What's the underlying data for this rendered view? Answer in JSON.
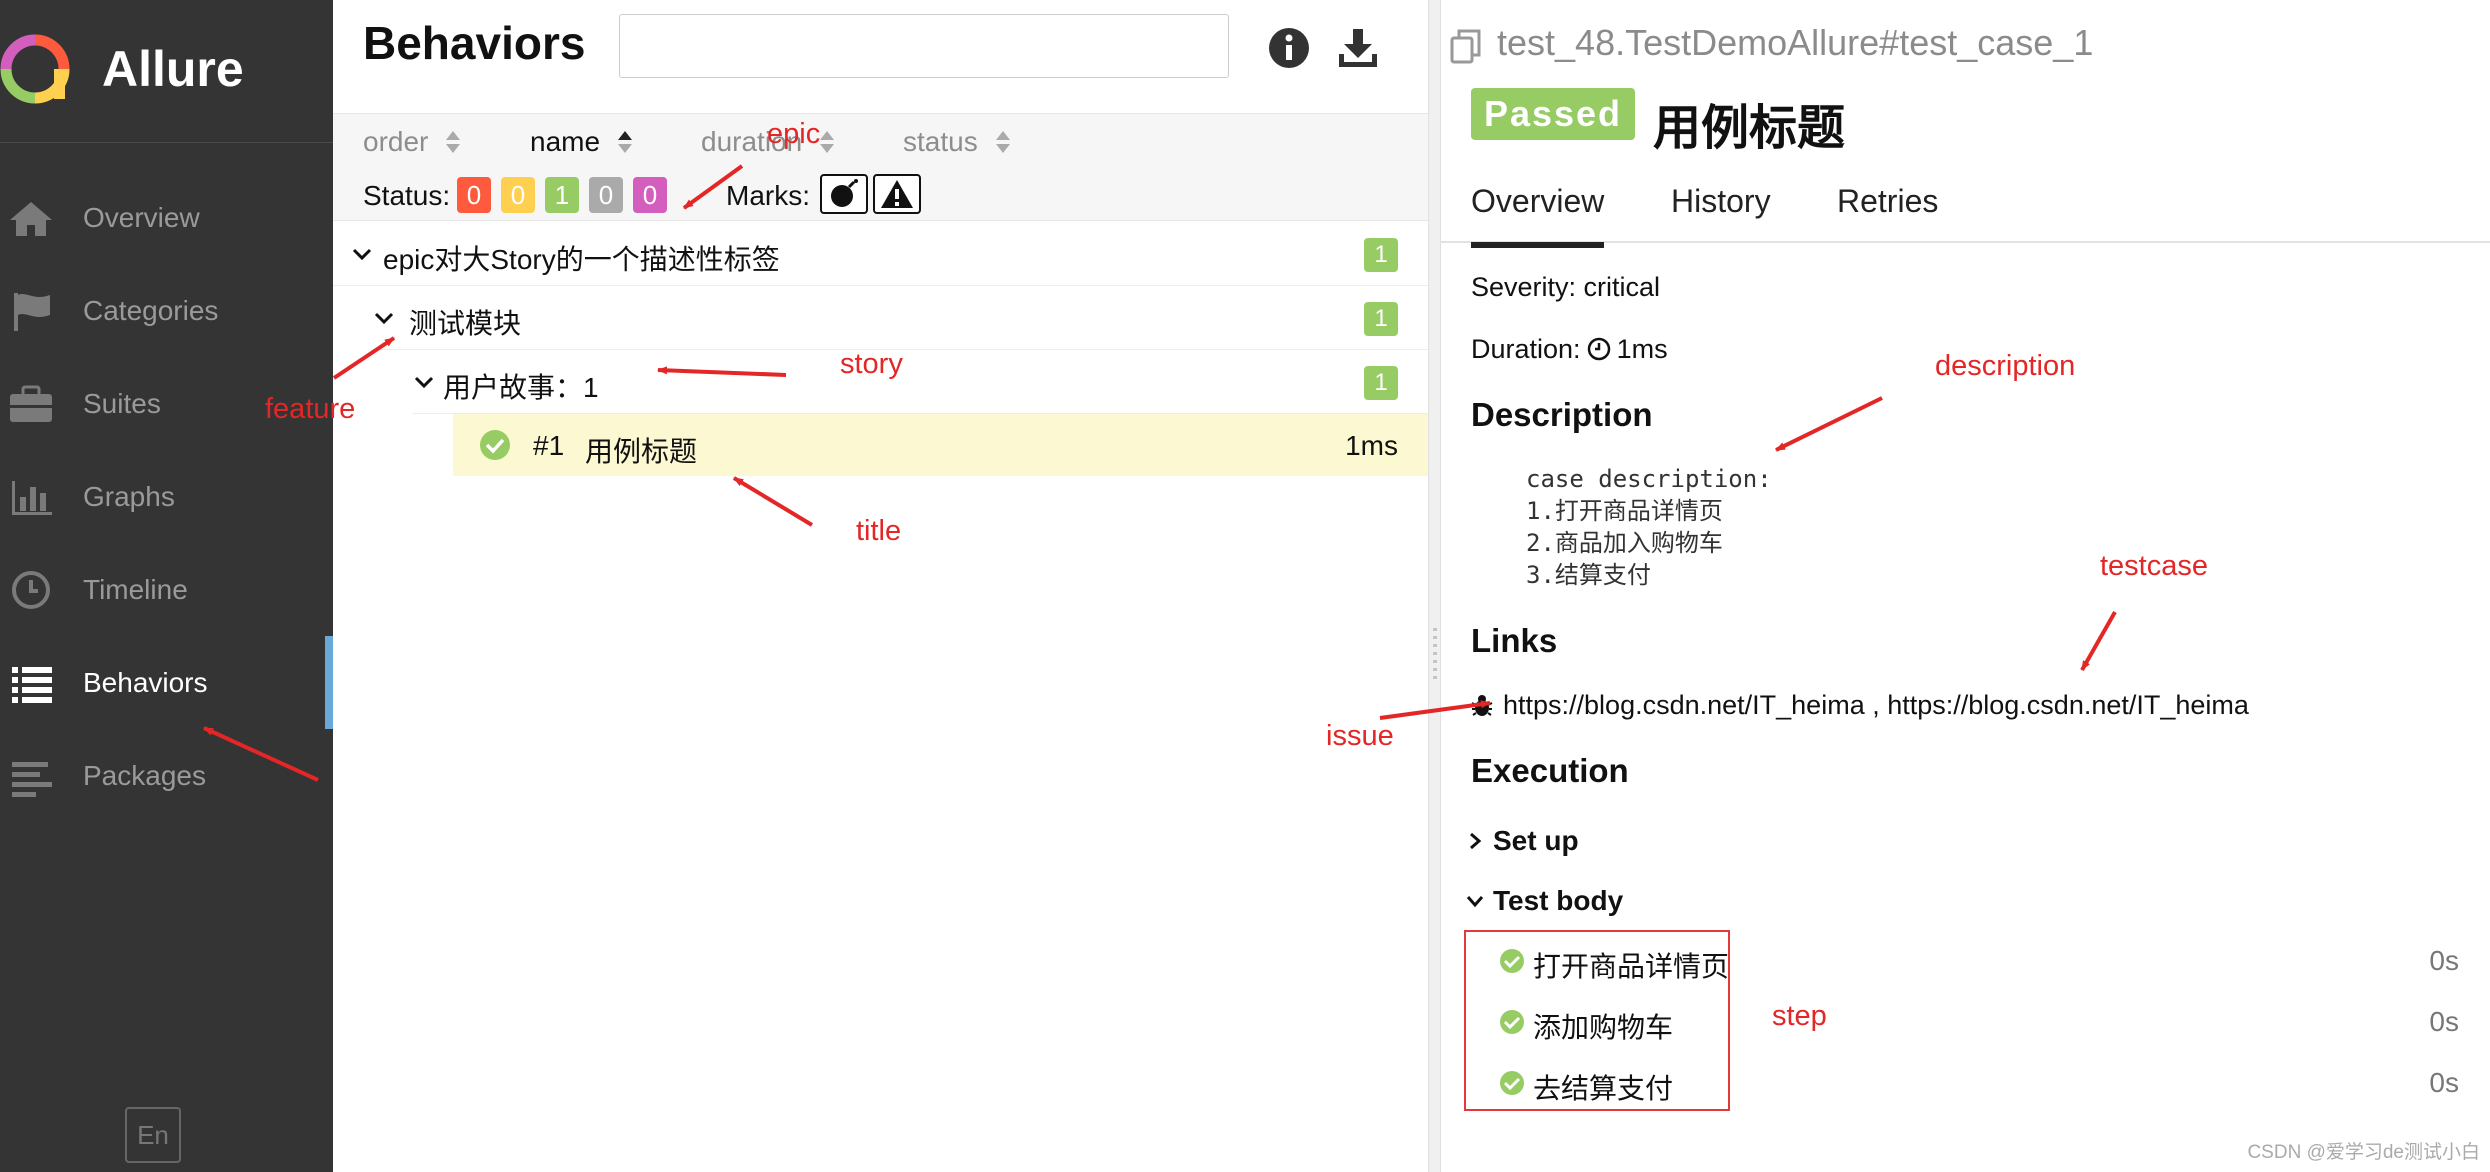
{
  "app": {
    "name": "Allure"
  },
  "sidebar": {
    "items": [
      {
        "label": "Overview",
        "icon": "home-icon"
      },
      {
        "label": "Categories",
        "icon": "flag-icon"
      },
      {
        "label": "Suites",
        "icon": "briefcase-icon"
      },
      {
        "label": "Graphs",
        "icon": "bar-chart-icon"
      },
      {
        "label": "Timeline",
        "icon": "clock-icon"
      },
      {
        "label": "Behaviors",
        "icon": "list-icon",
        "active": true
      },
      {
        "label": "Packages",
        "icon": "align-left-icon"
      }
    ],
    "language": "En"
  },
  "behaviors": {
    "title": "Behaviors",
    "search": {
      "value": "",
      "placeholder": ""
    },
    "sort": [
      {
        "label": "order"
      },
      {
        "label": "name",
        "active": true
      },
      {
        "label": "duration"
      },
      {
        "label": "status"
      }
    ],
    "status_label": "Status:",
    "status_counts": [
      {
        "value": "0",
        "color": "#fd5a3e"
      },
      {
        "value": "0",
        "color": "#ffd050"
      },
      {
        "value": "1",
        "color": "#97cc64"
      },
      {
        "value": "0",
        "color": "#aaaaaa"
      },
      {
        "value": "0",
        "color": "#d35ebe"
      }
    ],
    "marks_label": "Marks:",
    "tree": [
      {
        "label": "epic对大Story的一个描述性标签",
        "count": "1"
      },
      {
        "label": "测试模块",
        "count": "1"
      },
      {
        "label": "用户故事：1",
        "count": "1"
      }
    ],
    "case": {
      "number": "#1",
      "title": "用例标题",
      "duration": "1ms"
    }
  },
  "detail": {
    "path": "test_48.TestDemoAllure#test_case_1",
    "status": "Passed",
    "status_color": "#97cc64",
    "title": "用例标题",
    "tabs": [
      {
        "label": "Overview",
        "active": true
      },
      {
        "label": "History"
      },
      {
        "label": "Retries"
      }
    ],
    "severity": "Severity: critical",
    "duration_label": "Duration:",
    "duration_value": "1ms",
    "description_heading": "Description",
    "description_lines": [
      "case description:",
      "1.打开商品详情页",
      "2.商品加入购物车",
      "3.结算支付"
    ],
    "links_heading": "Links",
    "links": "https://blog.csdn.net/IT_heima , https://blog.csdn.net/IT_heima",
    "execution_heading": "Execution",
    "setup_label": "Set up",
    "body_label": "Test body",
    "steps": [
      {
        "label": "打开商品详情页",
        "duration": "0s"
      },
      {
        "label": "添加购物车",
        "duration": "0s"
      },
      {
        "label": "去结算支付",
        "duration": "0s"
      }
    ]
  },
  "annotations": {
    "epic": "epic",
    "feature": "feature",
    "story": "story",
    "title": "title",
    "description": "description",
    "testcase": "testcase",
    "issue": "issue",
    "step": "step",
    "color": "#e32626"
  },
  "watermark": "CSDN @爱学习de测试小白"
}
